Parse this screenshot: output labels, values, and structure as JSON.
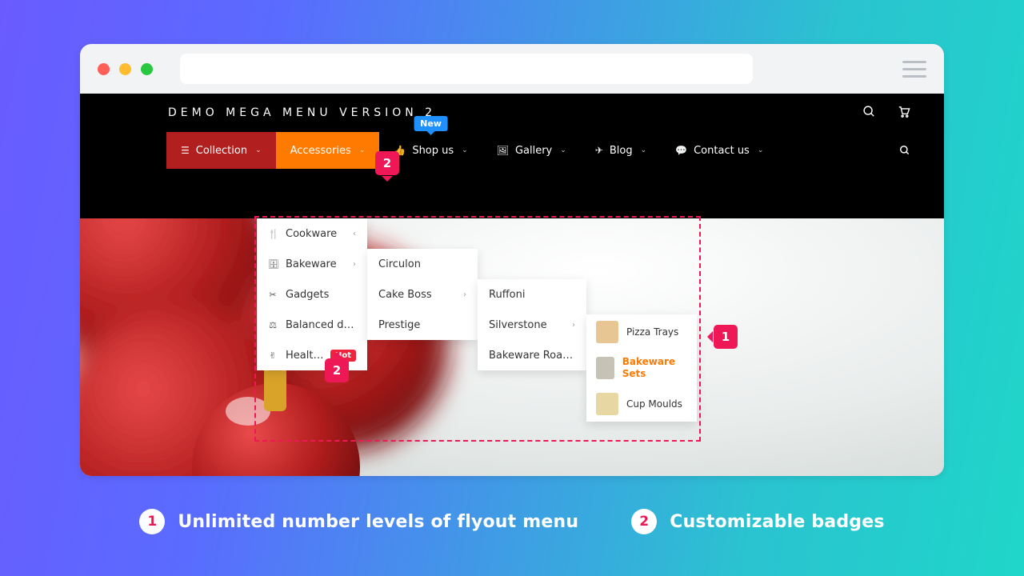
{
  "header": {
    "title": "DEMO MEGA MENU VERSION 2"
  },
  "chrome": {
    "dot_colors": [
      "#ff5f57",
      "#febc2e",
      "#28c840"
    ]
  },
  "nav": {
    "items": [
      {
        "label": "Collection",
        "icon": "list"
      },
      {
        "label": "Accessories",
        "icon": ""
      },
      {
        "label": "Shop us",
        "icon": "thumb",
        "badge": "New"
      },
      {
        "label": "Gallery",
        "icon": "image"
      },
      {
        "label": "Blog",
        "icon": "plane"
      },
      {
        "label": "Contact us",
        "icon": "chat"
      }
    ]
  },
  "flyout": {
    "level1": [
      {
        "icon": "🍴",
        "label": "Cookware",
        "arrow": "‹"
      },
      {
        "icon": "🗄",
        "label": "Bakeware",
        "arrow": "›"
      },
      {
        "icon": "✂",
        "label": "Gadgets"
      },
      {
        "icon": "⚖",
        "label": "Balanced diet"
      },
      {
        "icon": "✌",
        "label": "Healthy eating",
        "badge": "Hot"
      }
    ],
    "level2": [
      {
        "label": "Circulon"
      },
      {
        "label": "Cake Boss",
        "arrow": "›"
      },
      {
        "label": "Prestige"
      }
    ],
    "level3": [
      {
        "label": "Ruffoni"
      },
      {
        "label": "Silverstone",
        "arrow": "›"
      },
      {
        "label": "Bakeware Roasters"
      }
    ],
    "level4": [
      {
        "label": "Pizza Trays",
        "thumb": "#e8c693"
      },
      {
        "label": "Bakeware Sets",
        "thumb": "#c7c2b6",
        "active": true
      },
      {
        "label": "Cup Moulds",
        "thumb": "#e6d7a3"
      }
    ]
  },
  "annotations": {
    "m1": "1",
    "m2": "2",
    "legend": [
      {
        "num": "1",
        "text": "Unlimited number levels of flyout menu"
      },
      {
        "num": "2",
        "text": "Customizable badges"
      }
    ]
  }
}
